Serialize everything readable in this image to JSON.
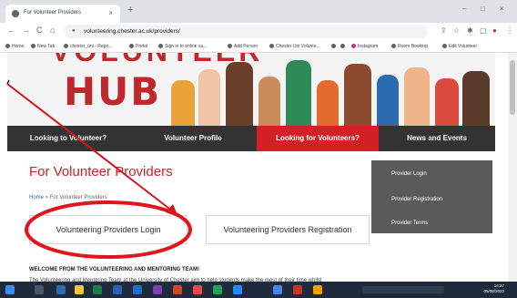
{
  "browser": {
    "tab_title": "For Volunteer Providers",
    "tab_close": "×",
    "new_tab": "+",
    "url": "volunteering.chester.ac.uk/providers/",
    "window_minimize": "–",
    "window_maximize": "□",
    "window_close": "×",
    "bookmarks": [
      "Home",
      "New Tab",
      "chester_uni - Repo...",
      "Portal",
      "Sign in to online su...",
      "Add Person",
      "Chester Uni Volunte...",
      "Instagram",
      "Room Booking",
      "Edit Volunteer"
    ]
  },
  "hero": {
    "top_word": "VOLUNTEER",
    "main_word": "HUB"
  },
  "nav": {
    "items": [
      "Looking to Volunteer?",
      "Volunteer Profile",
      "Looking for Volunteers?",
      "News and Events"
    ],
    "active_index": 2
  },
  "page": {
    "title": "For Volunteer Providers",
    "breadcrumb_home": "Home",
    "breadcrumb_sep": "»",
    "breadcrumb_current": "For Volunteer Providers",
    "login_button": "Volunteering Providers Login",
    "registration_button": "Volunteering Providers Registration",
    "welcome_heading": "WELCOME FROM THE VOLUNTEERING AND MENTORING TEAM!",
    "welcome_text": "The Volunteering and Mentoring Team at the University of Chester aim to help students make the most of their time whilst"
  },
  "sidebar": {
    "links": [
      "Provider Login",
      "Provider Registration",
      "Provider Terms"
    ]
  },
  "taskbar": {
    "time": "14:27",
    "date": "05/08/2022"
  },
  "colors": {
    "brand_red": "#d31f26",
    "nav_dark": "#333333",
    "sidebar_grey": "#5a5a5a"
  }
}
